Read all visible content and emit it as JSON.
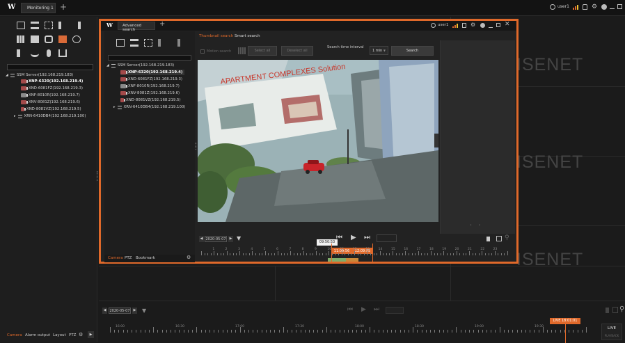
{
  "app": {
    "logo": "W",
    "tab_title": "Monitoring 1",
    "user": "user1"
  },
  "main_sidebar": {
    "server": "SSM Server(192.168.219.183)",
    "devices": [
      "XNP-6320(192.168.219.4)",
      "XND-6081FZ(192.168.219.3)",
      "XNF-8010R(192.168.219.7)",
      "XNV-8081Z(192.168.219.6)",
      "XND-8081VZ(192.168.219.5)",
      "XRN-6410DB4(192.168.219.100)"
    ],
    "bottom_tabs": [
      "Camera",
      "Alarm output",
      "Layout",
      "PTZ"
    ]
  },
  "wall_logo": "ISENET",
  "main_timeline": {
    "date": "2020-05-07",
    "live_badge": "LIVE 18:01:01",
    "live_label": "LIVE",
    "playback_label": "PLAYBACK",
    "hours": [
      "16:00",
      "16:30",
      "17:00",
      "17:30",
      "18:00",
      "18:30",
      "19:00",
      "19:30"
    ]
  },
  "adv": {
    "logo": "W",
    "tab_title": "Advanced search",
    "user": "user1",
    "tree": {
      "server": "SSM Server(192.168.219.183)",
      "devices": [
        "XNP-6320(192.168.219.4)",
        "XND-6081FZ(192.168.219.3)",
        "XNF-8010R(192.168.219.7)",
        "XNV-8081Z(192.168.219.6)",
        "XND-8081VZ(192.168.219.5)",
        "XRN-6410DB4(192.168.219.100)"
      ]
    },
    "bottom_tabs": [
      "Camera",
      "PTZ",
      "Bookmark"
    ],
    "search_tabs": [
      "Thumbnail search",
      "Smart search"
    ],
    "motion_search": "Motion search",
    "select_all": "Select all",
    "deselect_all": "Deselect all",
    "interval_label": "Search time interval",
    "interval_value": "1 min",
    "search_button": "Search",
    "video_sign": "APARTMENT COMPLEXES Solution",
    "date": "2020-05-07",
    "cursor_time": "09:50:53",
    "range_start": "11:09:56",
    "range_end": "12:09:55",
    "hours": [
      "1",
      "2",
      "3",
      "4",
      "5",
      "6",
      "7",
      "8",
      "9",
      "10",
      "11",
      "12",
      "13",
      "14",
      "15",
      "16",
      "17",
      "18",
      "19",
      "20",
      "21",
      "22",
      "23"
    ]
  },
  "colors": {
    "accent": "#e0692a",
    "bg": "#1b1b1b"
  }
}
